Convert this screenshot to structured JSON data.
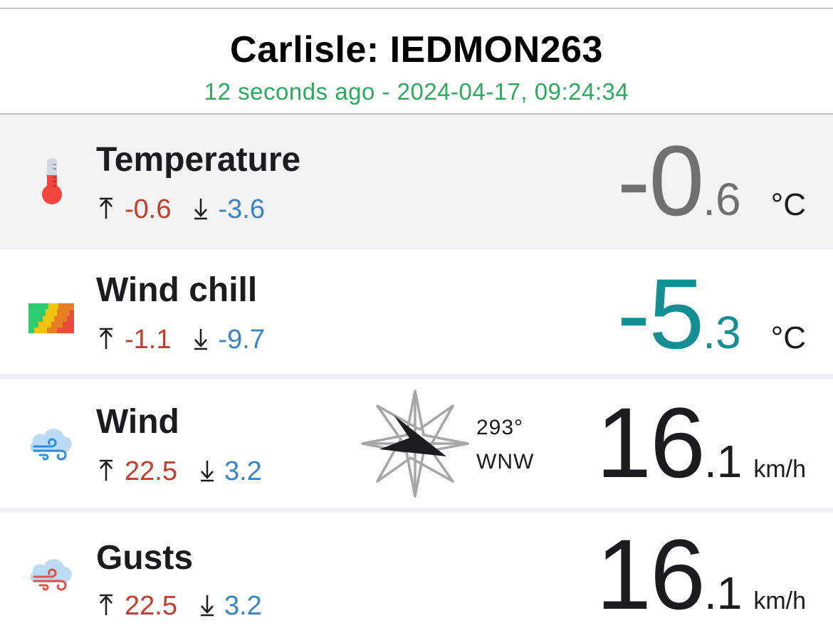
{
  "header": {
    "title": "Carlisle: IEDMON263",
    "updated": "12 seconds ago - 2024-04-17, 09:24:34"
  },
  "colors": {
    "updated_text": "#2eaa5e",
    "high": "#c2402b",
    "low": "#3a84c6",
    "temperature_value": "#707070",
    "windchill_value": "#138f94",
    "default_value": "#1c1c1e"
  },
  "rows": [
    {
      "id": "temperature",
      "icon": "thermometer-icon",
      "label": "Temperature",
      "high": "-0.6",
      "low": "-3.6",
      "value_int": "-0",
      "value_dec": ".6",
      "unit": "°C"
    },
    {
      "id": "wind-chill",
      "icon": "wind-chill-icon",
      "label": "Wind chill",
      "high": "-1.1",
      "low": "-9.7",
      "value_int": "-5",
      "value_dec": ".3",
      "unit": "°C"
    },
    {
      "id": "wind",
      "icon": "wind-cloud-icon",
      "label": "Wind",
      "high": "22.5",
      "low": "3.2",
      "value_int": "16",
      "value_dec": ".1",
      "unit": "km/h",
      "direction_degrees": "293°",
      "direction_cardinal": "WNW"
    },
    {
      "id": "gusts",
      "icon": "gust-cloud-icon",
      "label": "Gusts",
      "high": "22.5",
      "low": "3.2",
      "value_int": "16",
      "value_dec": ".1",
      "unit": "km/h"
    }
  ],
  "icons": {
    "up_arrow": "arrow-up-to-line-icon",
    "down_arrow": "arrow-down-to-line-icon",
    "compass": "compass-rose-icon"
  }
}
